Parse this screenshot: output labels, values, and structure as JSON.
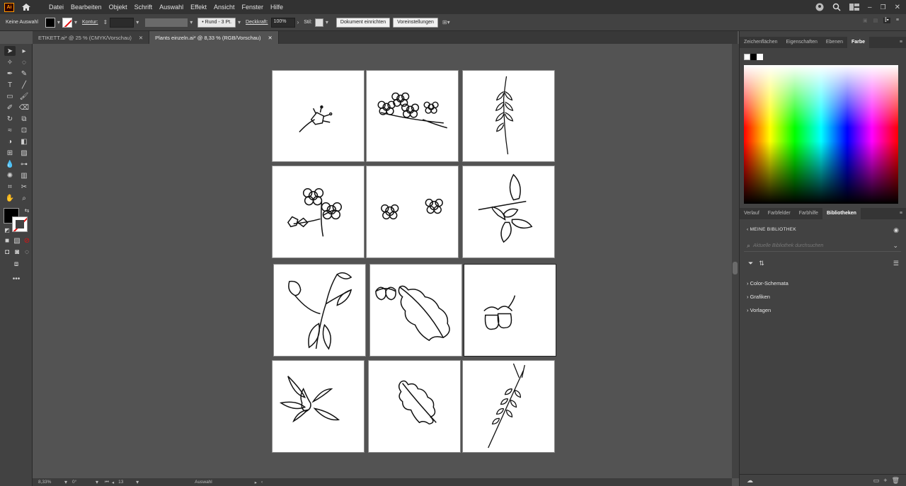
{
  "app": {
    "logo": "Ai"
  },
  "menu": [
    "Datei",
    "Bearbeiten",
    "Objekt",
    "Schrift",
    "Auswahl",
    "Effekt",
    "Ansicht",
    "Fenster",
    "Hilfe"
  ],
  "control": {
    "selection": "Keine Auswahl",
    "stroke_label": "Kontur:",
    "brush": "Rund - 3 Pt.",
    "opacity_label": "Deckkraft:",
    "opacity_value": "100%",
    "style_label": "Stil:",
    "doc_setup": "Dokument einrichten",
    "preferences": "Voreinstellungen"
  },
  "tabs": [
    {
      "label": "ETIKETT.ai* @ 25 % (CMYK/Vorschau)",
      "active": false
    },
    {
      "label": "Plants einzeln.ai* @ 8,33 % (RGB/Vorschau)",
      "active": true
    }
  ],
  "artboards": [
    {
      "icon": "flower-sprig-icon"
    },
    {
      "icon": "blossom-branch-icon"
    },
    {
      "icon": "wheat-icon"
    },
    {
      "icon": "flower-cluster-icon"
    },
    {
      "icon": "two-flowers-icon"
    },
    {
      "icon": "leaf-branch-icon"
    },
    {
      "icon": "rosebud-icon"
    },
    {
      "icon": "oak-leaf-acorns-icon"
    },
    {
      "icon": "acorns-icon"
    },
    {
      "icon": "acorn-leaves-icon"
    },
    {
      "icon": "oak-leaf-icon"
    },
    {
      "icon": "wheat-ear-icon"
    }
  ],
  "status": {
    "zoom": "8,33%",
    "rotation": "0°",
    "artboard_number": "13",
    "tool": "Auswahl"
  },
  "panels": {
    "top_tabs": [
      "Zeichenflächen",
      "Eigenschaften",
      "Ebenen",
      "Farbe"
    ],
    "bottom_tabs": [
      "Verlauf",
      "Farbfelder",
      "Farbhilfe",
      "Bibliotheken"
    ],
    "library_title": "MEINE BIBLIOTHEK",
    "search_placeholder": "Aktuelle Bibliothek durchsuchen",
    "sections": [
      "Color-Schemata",
      "Grafiken",
      "Vorlagen"
    ]
  }
}
